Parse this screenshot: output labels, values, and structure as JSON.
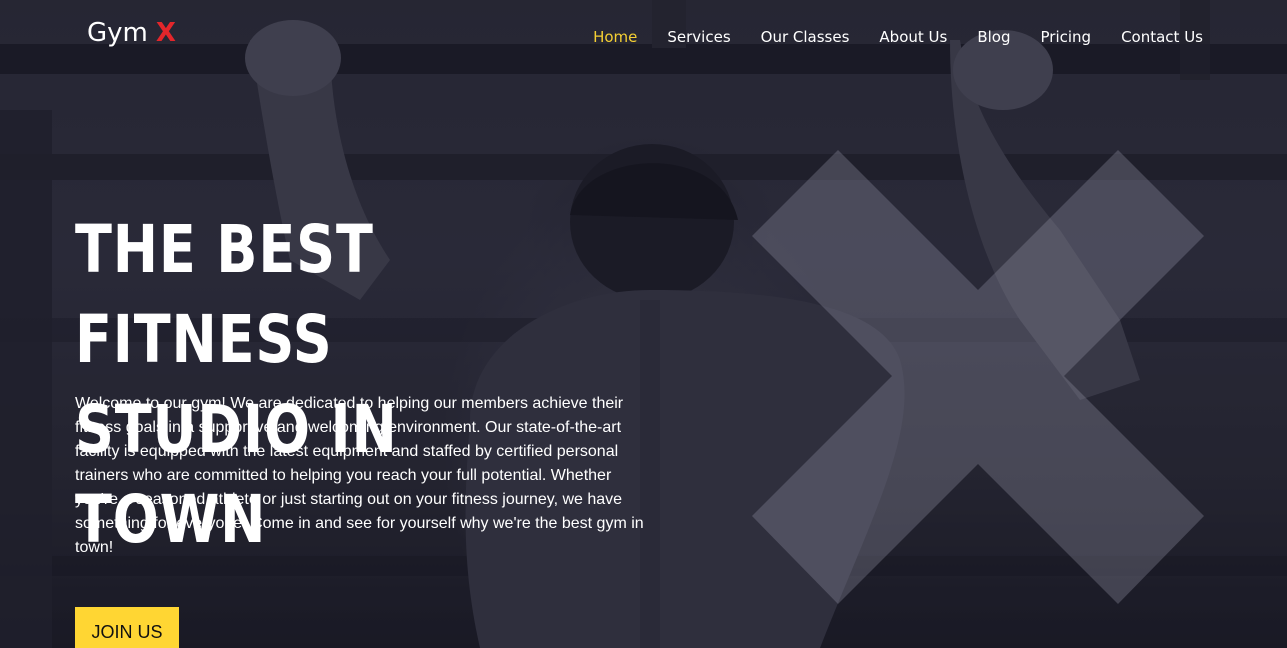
{
  "brand": {
    "name": "Gym",
    "accent_letter": "X",
    "accent_color": "#e3262b"
  },
  "nav": {
    "items": [
      {
        "label": "Home",
        "active": true
      },
      {
        "label": "Services",
        "active": false
      },
      {
        "label": "Our Classes",
        "active": false
      },
      {
        "label": "About Us",
        "active": false
      },
      {
        "label": "Blog",
        "active": false
      },
      {
        "label": "Pricing",
        "active": false
      },
      {
        "label": "Contact Us",
        "active": false
      }
    ],
    "active_color": "#f5d033"
  },
  "hero": {
    "title_line1": "THE BEST FITNESS",
    "title_line2": "STUDIO IN TOWN",
    "description": "Welcome to our gym! We are dedicated to helping our members achieve their fitness goals in a supportive and welcoming environment. Our state-of-the-art facility is equipped with the latest equipment and staffed by certified personal trainers who are committed to helping you reach your full potential. Whether you're a seasoned athlete or just starting out on your fitness journey, we have something for everyone. Come in and see for yourself why we're the best gym in town!",
    "cta_label": "JOIN US",
    "cta_color": "#ffd633",
    "background_icon": "athlete-pullup-photo",
    "decor_icon": "x-mark-icon"
  }
}
